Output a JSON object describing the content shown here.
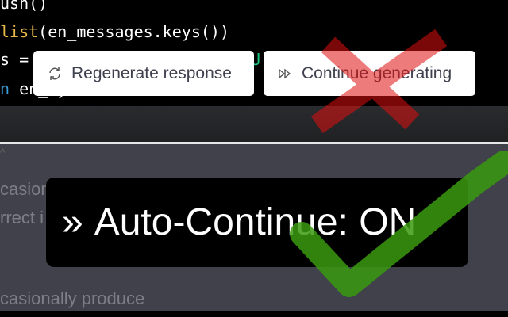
{
  "code_lines": {
    "l1": "ush()",
    "l2_kw": "list",
    "l2_rest": "(en_messages.keys())",
    "l3": "s = ",
    "l3_tail": "U",
    "l4_kw": "n",
    "l4_rest": " en_ey"
  },
  "buttons": {
    "regenerate": "Regenerate response",
    "continue": "Continue generating"
  },
  "chat_text": {
    "line1": "casion",
    "line2": "rrect i",
    "line3": "casionally produce"
  },
  "popup": {
    "icon": "»",
    "label": "Auto-Continue: ON"
  },
  "colors": {
    "cross": "#e02020",
    "check": "#3a9a10"
  }
}
